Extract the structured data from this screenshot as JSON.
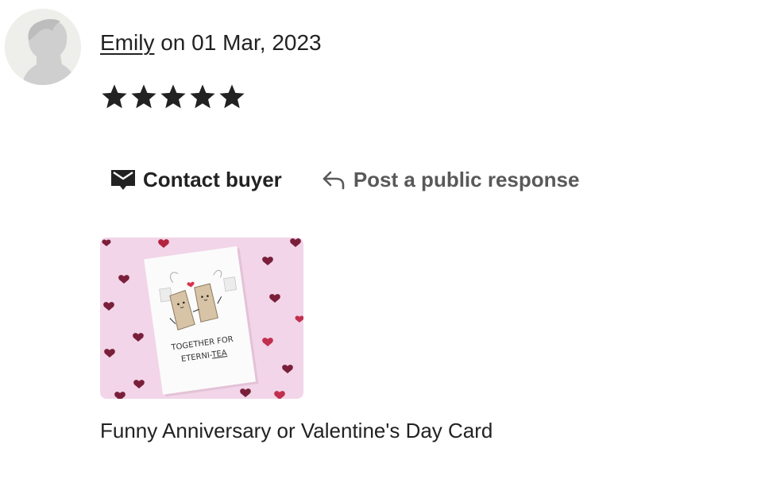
{
  "review": {
    "avatar_icon": "default-user-silhouette",
    "reviewer_name": "Emily",
    "date_text": "on 01 Mar, 2023",
    "rating": 5,
    "rating_max": 5
  },
  "actions": {
    "contact_label": "Contact buyer",
    "contact_icon": "envelope-icon",
    "response_label": "Post a public response",
    "response_icon": "reply-arrow-icon"
  },
  "product": {
    "card_text_line1": "TOGETHER FOR",
    "card_text_line2_prefix": "ETERNI-",
    "card_text_line2_emph": "TEA",
    "title": "Funny Anniversary or Valentine's Day Card"
  },
  "colors": {
    "text": "#222222",
    "muted": "#595959",
    "thumbnail_bg": "#f2d5e8",
    "heart": "#7a1f3a"
  }
}
